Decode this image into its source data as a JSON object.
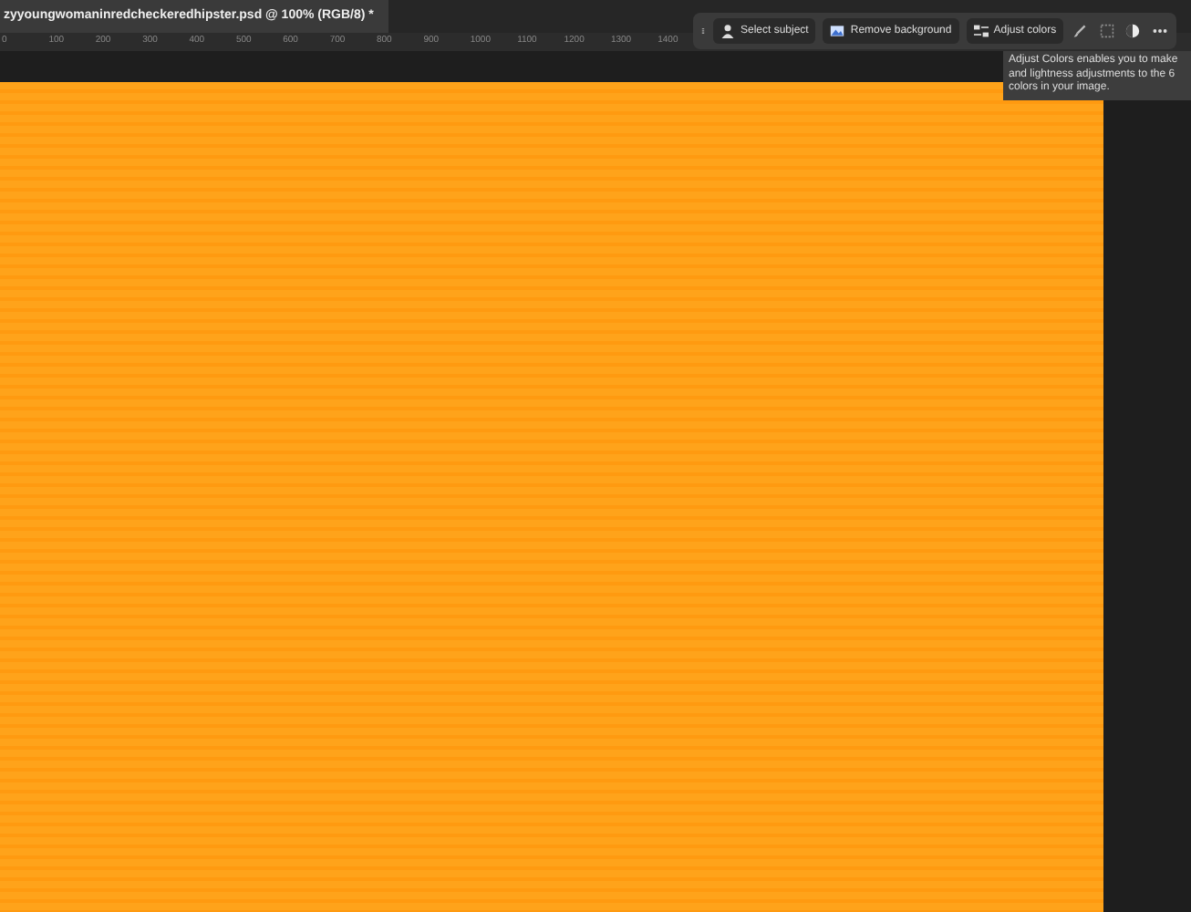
{
  "document_tab": {
    "title": "zyyoungwomaninredcheckeredhipster.psd @ 100% (RGB/8) *"
  },
  "ruler": {
    "labels": [
      "0",
      "100",
      "200",
      "300",
      "400",
      "500",
      "600",
      "700",
      "800",
      "900",
      "1000",
      "1100",
      "1200",
      "1300",
      "1400"
    ]
  },
  "contextual_task_bar": {
    "buttons": [
      {
        "label": "Select subject",
        "kind": "person"
      },
      {
        "label": "Remove background",
        "kind": "image"
      },
      {
        "label": "Adjust colors",
        "kind": "sliders"
      }
    ],
    "tools": [
      {
        "kind": "brush"
      },
      {
        "kind": "selection"
      },
      {
        "kind": "contrast"
      },
      {
        "kind": "more"
      }
    ]
  },
  "tooltip": {
    "lines": [
      "Adjust Colors enables you to make",
      "and lightness adjustments to the 6",
      "colors in your image."
    ]
  }
}
